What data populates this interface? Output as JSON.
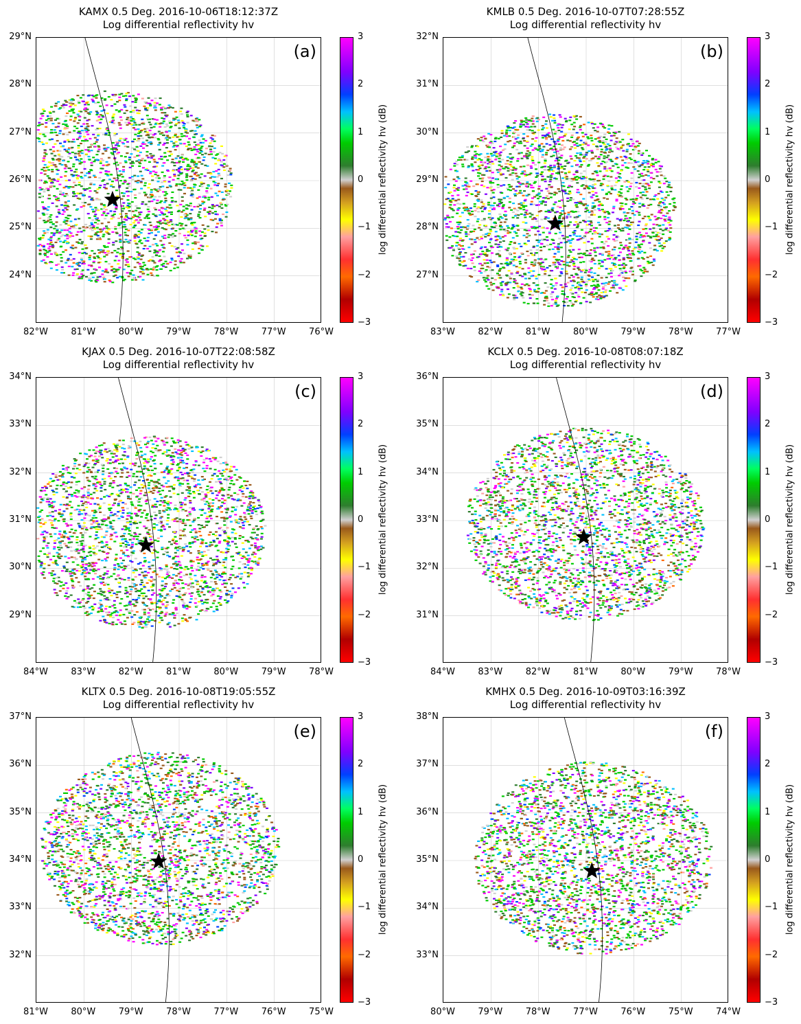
{
  "panels": [
    {
      "title_line1": "KAMX 0.5 Deg. 2016-10-06T18:12:37Z",
      "title_line2": "Log differential reflectivity hv",
      "letter": "(a)",
      "lat_ticks": [
        "29°N",
        "28°N",
        "27°N",
        "26°N",
        "25°N",
        "24°N"
      ],
      "lon_ticks": [
        "82°W",
        "81°W",
        "80°W",
        "79°W",
        "78°W",
        "77°W",
        "76°W"
      ],
      "star": {
        "lon": -80.4,
        "lat": 25.6
      },
      "lon_range": [
        -82,
        -76
      ],
      "lat_range": [
        23,
        29
      ]
    },
    {
      "title_line1": "KMLB 0.5 Deg. 2016-10-07T07:28:55Z",
      "title_line2": "Log differential reflectivity hv",
      "letter": "(b)",
      "lat_ticks": [
        "32°N",
        "31°N",
        "30°N",
        "29°N",
        "28°N",
        "27°N"
      ],
      "lon_ticks": [
        "83°W",
        "82°W",
        "81°W",
        "80°W",
        "79°W",
        "78°W",
        "77°W"
      ],
      "star": {
        "lon": -80.65,
        "lat": 28.1
      },
      "lon_range": [
        -83,
        -77
      ],
      "lat_range": [
        26,
        32
      ]
    },
    {
      "title_line1": "KJAX 0.5 Deg. 2016-10-07T22:08:58Z",
      "title_line2": "Log differential reflectivity hv",
      "letter": "(c)",
      "lat_ticks": [
        "34°N",
        "33°N",
        "32°N",
        "31°N",
        "30°N",
        "29°N"
      ],
      "lon_ticks": [
        "84°W",
        "83°W",
        "82°W",
        "81°W",
        "80°W",
        "79°W",
        "78°W"
      ],
      "star": {
        "lon": -81.7,
        "lat": 30.48
      },
      "lon_range": [
        -84,
        -78
      ],
      "lat_range": [
        28,
        34
      ]
    },
    {
      "title_line1": "KCLX 0.5 Deg. 2016-10-08T08:07:18Z",
      "title_line2": "Log differential reflectivity hv",
      "letter": "(d)",
      "lat_ticks": [
        "36°N",
        "35°N",
        "34°N",
        "33°N",
        "32°N",
        "31°N"
      ],
      "lon_ticks": [
        "84°W",
        "83°W",
        "82°W",
        "81°W",
        "80°W",
        "79°W",
        "78°W"
      ],
      "star": {
        "lon": -81.05,
        "lat": 32.65
      },
      "lon_range": [
        -84,
        -78
      ],
      "lat_range": [
        30,
        36
      ]
    },
    {
      "title_line1": "KLTX 0.5 Deg. 2016-10-08T19:05:55Z",
      "title_line2": "Log differential reflectivity hv",
      "letter": "(e)",
      "lat_ticks": [
        "37°N",
        "36°N",
        "35°N",
        "34°N",
        "33°N",
        "32°N"
      ],
      "lon_ticks": [
        "81°W",
        "80°W",
        "79°W",
        "78°W",
        "77°W",
        "76°W",
        "75°W"
      ],
      "star": {
        "lon": -78.43,
        "lat": 33.98
      },
      "lon_range": [
        -81,
        -75
      ],
      "lat_range": [
        31,
        37
      ]
    },
    {
      "title_line1": "KMHX 0.5 Deg. 2016-10-09T03:16:39Z",
      "title_line2": "Log differential reflectivity hv",
      "letter": "(f)",
      "lat_ticks": [
        "38°N",
        "37°N",
        "36°N",
        "35°N",
        "34°N",
        "33°N"
      ],
      "lon_ticks": [
        "80°W",
        "79°W",
        "78°W",
        "77°W",
        "76°W",
        "75°W",
        "74°W"
      ],
      "star": {
        "lon": -76.88,
        "lat": 34.78
      },
      "lon_range": [
        -80,
        -74
      ],
      "lat_range": [
        32,
        38
      ]
    }
  ],
  "colorbar": {
    "label": "log differential reflectivity hv (dB)",
    "ticks": [
      "3",
      "2",
      "1",
      "0",
      "−1",
      "−2",
      "−3"
    ],
    "vmin": -3,
    "vmax": 3,
    "colors": [
      "#ff0000",
      "#b00000",
      "#ff6a00",
      "#ffa0a0",
      "#ffff00",
      "#9a5a1c",
      "#d0d0d0",
      "#2e7d2e",
      "#00cc00",
      "#00c0ff",
      "#0040ff",
      "#8000ff",
      "#ff00ff"
    ]
  }
}
